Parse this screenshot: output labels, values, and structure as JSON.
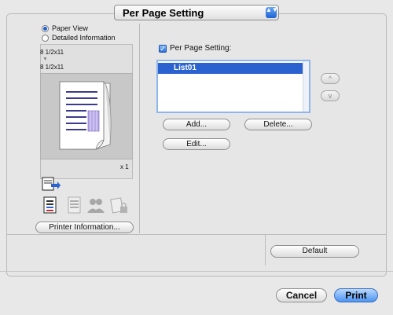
{
  "panel_popup": {
    "label": "Per Page Setting",
    "arrows": "▲▼"
  },
  "view_options": [
    {
      "label": "Paper View",
      "selected": true
    },
    {
      "label": "Detailed Information",
      "selected": false
    }
  ],
  "preview": {
    "size_from": "8 1/2x11",
    "size_arrow": "▼",
    "size_to": "8 1/2x11",
    "copies": "x 1"
  },
  "icons": {
    "output_icon": "output-tray-icon",
    "row2": [
      "document-icon",
      "text-doc-icon",
      "people-icon",
      "lock-doc-icon"
    ]
  },
  "printer_info_button": "Printer Information...",
  "per_page": {
    "checkbox_label": "Per Page Setting:",
    "checked": true,
    "check_glyph": "✓",
    "list_items": [
      "List01"
    ],
    "up_glyph": "^",
    "down_glyph": "v",
    "add_button": "Add...",
    "delete_button": "Delete...",
    "edit_button": "Edit..."
  },
  "default_button": "Default",
  "footer": {
    "cancel_button": "Cancel",
    "print_button": "Print"
  },
  "colors": {
    "accent": "#2a63d0",
    "background": "#e8e8e8"
  }
}
